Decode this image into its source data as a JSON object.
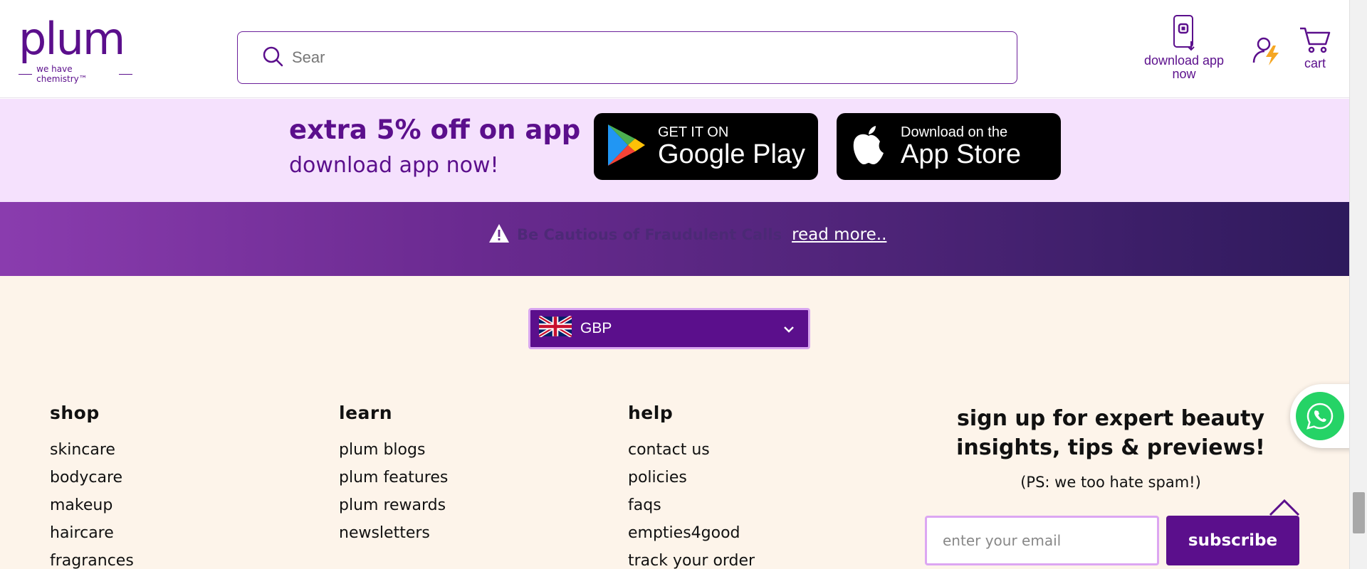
{
  "header": {
    "logo_word": "plum",
    "logo_tagline": "we have chemistry™",
    "search_placeholder": "Sear",
    "download_app_label": "download app now",
    "cart_label": "cart"
  },
  "promo": {
    "title": "extra 5% off on app",
    "subtitle": "download app now!",
    "google_play": {
      "small": "GET IT ON",
      "big": "Google Play"
    },
    "app_store": {
      "small": "Download on the",
      "big": "App Store"
    }
  },
  "banner": {
    "text": "Be Cautious of Fraudulent Calls",
    "link": "read more.."
  },
  "currency": {
    "selected": "GBP"
  },
  "footer": {
    "columns": [
      {
        "heading": "shop",
        "links": [
          "skincare",
          "bodycare",
          "makeup",
          "haircare",
          "fragrances"
        ]
      },
      {
        "heading": "learn",
        "links": [
          "plum blogs",
          "plum features",
          "plum rewards",
          "newsletters"
        ]
      },
      {
        "heading": "help",
        "links": [
          "contact us",
          "policies",
          "faqs",
          "empties4good",
          "track your order"
        ]
      }
    ],
    "signup": {
      "title": "sign up for expert beauty insights, tips & previews!",
      "note": "(PS: we too hate spam!)",
      "email_placeholder": "enter your email",
      "button": "subscribe"
    }
  },
  "colors": {
    "brand_purple": "#5b0f8c",
    "promo_bg": "#f5e1fd",
    "footer_bg": "#fdf4ea",
    "whatsapp_green": "#25d366"
  },
  "icons": [
    "search-icon",
    "phone-download-icon",
    "account-icon",
    "cart-icon",
    "google-play-icon",
    "apple-icon",
    "warning-icon",
    "uk-flag-icon",
    "chevron-down-icon",
    "chevron-up-icon",
    "whatsapp-icon"
  ]
}
